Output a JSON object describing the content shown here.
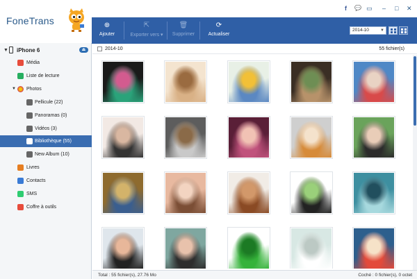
{
  "app": {
    "title": "FoneTrans"
  },
  "window_controls": {
    "facebook": "f",
    "chat": "💬",
    "feedback": "▭",
    "minimize": "–",
    "maximize": "□",
    "close": "✕"
  },
  "device": {
    "name": "iPhone 6",
    "eject": "⏏"
  },
  "sidebar": {
    "items": [
      {
        "label": "Média",
        "icon": "media-icon",
        "color": "#e74c3c"
      },
      {
        "label": "Liste de lecture",
        "icon": "playlist-icon",
        "color": "#27ae60"
      },
      {
        "label": "Photos",
        "icon": "photos-icon",
        "color": "#f39c12"
      },
      {
        "label": "Pellicule (22)",
        "icon": "camera-icon",
        "color": "#555555"
      },
      {
        "label": "Panoramas (0)",
        "icon": "camera-icon",
        "color": "#555555"
      },
      {
        "label": "Vidéos (3)",
        "icon": "camera-icon",
        "color": "#555555"
      },
      {
        "label": "Bibliothèque (55)",
        "icon": "camera-icon",
        "color": "#ffffff"
      },
      {
        "label": "New Album (10)",
        "icon": "camera-icon",
        "color": "#555555"
      },
      {
        "label": "Livres",
        "icon": "books-icon",
        "color": "#e67e22"
      },
      {
        "label": "Contacts",
        "icon": "contacts-icon",
        "color": "#3a7bd5"
      },
      {
        "label": "SMS",
        "icon": "sms-icon",
        "color": "#2ecc71"
      },
      {
        "label": "Coffre à outils",
        "icon": "toolbox-icon",
        "color": "#e74c3c"
      }
    ]
  },
  "toolbar": {
    "add": "Ajouter",
    "export": "Exporter vers",
    "delete": "Supprimer",
    "refresh": "Actualiser",
    "date_select": "2014-10"
  },
  "content": {
    "group_label": "2014-10",
    "group_count": "55 fichier(s)"
  },
  "status": {
    "total": "Total : 55 fichier(s), 27.76 Mo",
    "checked": "Coché : 0 fichier(s), 0 octet"
  },
  "thumbnails": [
    {
      "name": "filmstrip-photo",
      "colors": [
        "#1a1a1a",
        "#2aa37a",
        "#d35b8f"
      ]
    },
    {
      "name": "puppy-photo",
      "colors": [
        "#f4e4cf",
        "#d9b186",
        "#9a6b40"
      ]
    },
    {
      "name": "postcards-photo",
      "colors": [
        "#e8f0e6",
        "#5b88c2",
        "#f2c037"
      ]
    },
    {
      "name": "collage-photo",
      "colors": [
        "#3a2e24",
        "#b7926a",
        "#6e8e54"
      ]
    },
    {
      "name": "plush-toy-photo",
      "colors": [
        "#4f88c6",
        "#d84a4a",
        "#e9d3c4"
      ]
    },
    {
      "name": "girl-portrait-photo",
      "colors": [
        "#f2e9e4",
        "#333333",
        "#d9b7a1"
      ]
    },
    {
      "name": "koala-photo",
      "colors": [
        "#5d5d5d",
        "#c9c9c9",
        "#8a6a48"
      ]
    },
    {
      "name": "girl-pink-photo",
      "colors": [
        "#5a1f37",
        "#c0527c",
        "#f1c2b4"
      ]
    },
    {
      "name": "kitten-photo",
      "colors": [
        "#cfcfcf",
        "#d68b3a",
        "#f4e2cc"
      ]
    },
    {
      "name": "girl-green-photo",
      "colors": [
        "#6aa35b",
        "#2b2b2b",
        "#e9cdb8"
      ]
    },
    {
      "name": "autumn-girl-photo",
      "colors": [
        "#8e6b2f",
        "#3a5e8f",
        "#d3b36a"
      ]
    },
    {
      "name": "eye-closeup-photo",
      "colors": [
        "#e8b9a0",
        "#7b4e35",
        "#f3d4c1"
      ]
    },
    {
      "name": "brown-puppy-photo",
      "colors": [
        "#f1ece6",
        "#8a4a24",
        "#d2986a"
      ]
    },
    {
      "name": "panda-cartoon-photo",
      "colors": [
        "#ffffff",
        "#222222",
        "#9ad07a"
      ]
    },
    {
      "name": "teal-art-photo",
      "colors": [
        "#3e8fa0",
        "#a7d9de",
        "#214f5e"
      ]
    },
    {
      "name": "smiling-girl-photo",
      "colors": [
        "#dfe6ec",
        "#222222",
        "#e8b79a"
      ]
    },
    {
      "name": "girl-blur-photo",
      "colors": [
        "#7fa7a0",
        "#2d2d2d",
        "#e8c2ac"
      ]
    },
    {
      "name": "3d-logo-photo",
      "colors": [
        "#ffffff",
        "#35b33a",
        "#1c7a24"
      ]
    },
    {
      "name": "white-dog-photo",
      "colors": [
        "#d8e8e4",
        "#ffffff",
        "#bcc9c4"
      ]
    },
    {
      "name": "cartoon-blue-photo",
      "colors": [
        "#2d5f8d",
        "#e34a3a",
        "#f6e2c8"
      ]
    }
  ]
}
